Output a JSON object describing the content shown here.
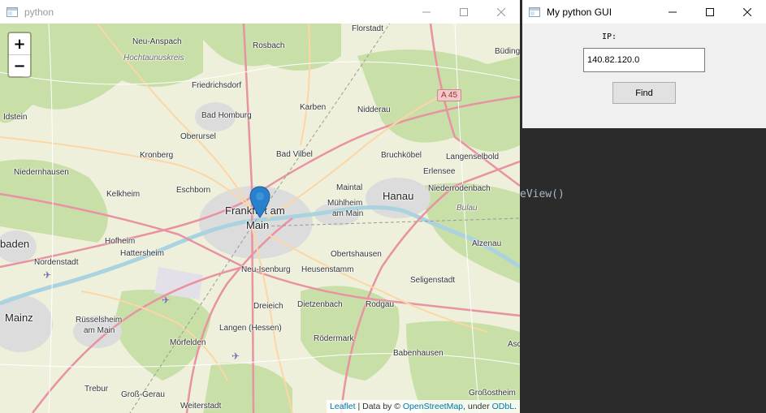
{
  "map_window": {
    "title": "python",
    "controls": [
      "minimize-icon",
      "maximize-icon",
      "close-icon"
    ],
    "zoom": {
      "in_label": "+",
      "out_label": "−"
    },
    "labels": [
      {
        "text": "Florstadt",
        "cls": ""
      },
      {
        "text": "Neu-Anspach",
        "cls": ""
      },
      {
        "text": "Hochtaunuskreis",
        "cls": "italic"
      },
      {
        "text": "Rosbach",
        "cls": ""
      },
      {
        "text": "Büding",
        "cls": ""
      },
      {
        "text": "Friedrichsdorf",
        "cls": ""
      },
      {
        "text": "Idstein",
        "cls": ""
      },
      {
        "text": "Bad Homburg",
        "cls": ""
      },
      {
        "text": "Karben",
        "cls": ""
      },
      {
        "text": "Nidderau",
        "cls": ""
      },
      {
        "text": "Oberursel",
        "cls": ""
      },
      {
        "text": "Kronberg",
        "cls": ""
      },
      {
        "text": "Bad Vilbel",
        "cls": ""
      },
      {
        "text": "Bruchköbel",
        "cls": ""
      },
      {
        "text": "Langenselbold",
        "cls": ""
      },
      {
        "text": "Niedernhausen",
        "cls": ""
      },
      {
        "text": "Erlensee",
        "cls": ""
      },
      {
        "text": "Eschborn",
        "cls": ""
      },
      {
        "text": "Maintal",
        "cls": ""
      },
      {
        "text": "Kelkheim",
        "cls": ""
      },
      {
        "text": "Hanau",
        "cls": "big"
      },
      {
        "text": "Niederrodenbach",
        "cls": ""
      },
      {
        "text": "Mühlheim",
        "cls": ""
      },
      {
        "text": "am Main",
        "cls": ""
      },
      {
        "text": "Bulau",
        "cls": "italic"
      },
      {
        "text": "Frankfurt am",
        "cls": "big"
      },
      {
        "text": "Main",
        "cls": "big"
      },
      {
        "text": "baden",
        "cls": "big"
      },
      {
        "text": "Hofheim",
        "cls": ""
      },
      {
        "text": "Alzenau",
        "cls": ""
      },
      {
        "text": "Hattersheim",
        "cls": ""
      },
      {
        "text": "Obertshausen",
        "cls": ""
      },
      {
        "text": "Nordenstadt",
        "cls": ""
      },
      {
        "text": "Neu-Isenburg",
        "cls": ""
      },
      {
        "text": "Heusenstamm",
        "cls": ""
      },
      {
        "text": "Seligenstadt",
        "cls": ""
      },
      {
        "text": "Dreieich",
        "cls": ""
      },
      {
        "text": "Dietzenbach",
        "cls": ""
      },
      {
        "text": "Rodgau",
        "cls": ""
      },
      {
        "text": "Mainz",
        "cls": "big"
      },
      {
        "text": "Rüsselsheim",
        "cls": ""
      },
      {
        "text": "am Main",
        "cls": ""
      },
      {
        "text": "Langen (Hessen)",
        "cls": ""
      },
      {
        "text": "Rödermark",
        "cls": ""
      },
      {
        "text": "Mörfelden",
        "cls": ""
      },
      {
        "text": "Aschaffenburg",
        "cls": ""
      },
      {
        "text": "Babenhausen",
        "cls": ""
      },
      {
        "text": "Trebur",
        "cls": ""
      },
      {
        "text": "Groß-Gerau",
        "cls": ""
      },
      {
        "text": "Weiterstadt",
        "cls": ""
      },
      {
        "text": "Großostheim",
        "cls": ""
      }
    ],
    "road_shield": "A 45",
    "attribution": {
      "leaflet": "Leaflet",
      "sep1": " | Data by © ",
      "osm": "OpenStreetMap",
      "sep2": ", under ",
      "odbl": "ODbL",
      "end": "."
    }
  },
  "gui_window": {
    "title": "My python GUI",
    "ip_label": "IP:",
    "ip_value": "140.82.120.0",
    "find_label": "Find"
  },
  "background_editor": {
    "code_fragment": "eView()"
  }
}
